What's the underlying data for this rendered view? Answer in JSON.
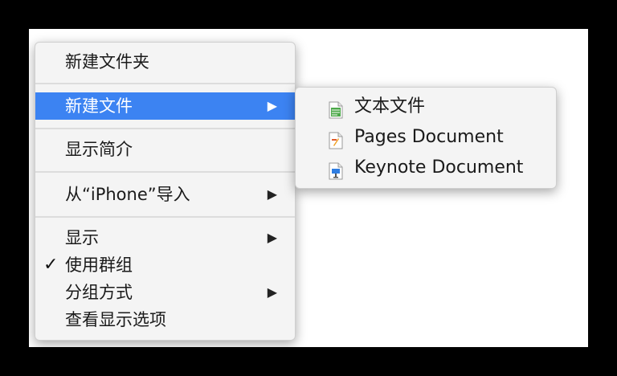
{
  "main_menu": {
    "items": [
      {
        "label": "新建文件夹"
      },
      {
        "label": "新建文件",
        "has_submenu": true,
        "selected": true
      },
      {
        "label": "显示简介"
      },
      {
        "label": "从“iPhone”导入",
        "has_submenu": true
      },
      {
        "label": "显示",
        "has_submenu": true
      },
      {
        "label": "使用群组",
        "checked": true
      },
      {
        "label": "分组方式",
        "has_submenu": true
      },
      {
        "label": "查看显示选项"
      }
    ],
    "arrow_glyph": "▶",
    "check_glyph": "✓"
  },
  "sub_menu": {
    "items": [
      {
        "label": "文本文件",
        "icon": "text-file-icon"
      },
      {
        "label": "Pages Document",
        "icon": "pages-document-icon"
      },
      {
        "label": "Keynote Document",
        "icon": "keynote-document-icon"
      }
    ]
  },
  "colors": {
    "selection": "#3c83f2",
    "menu_background": "#f4f4f4",
    "backdrop": "#000000"
  }
}
